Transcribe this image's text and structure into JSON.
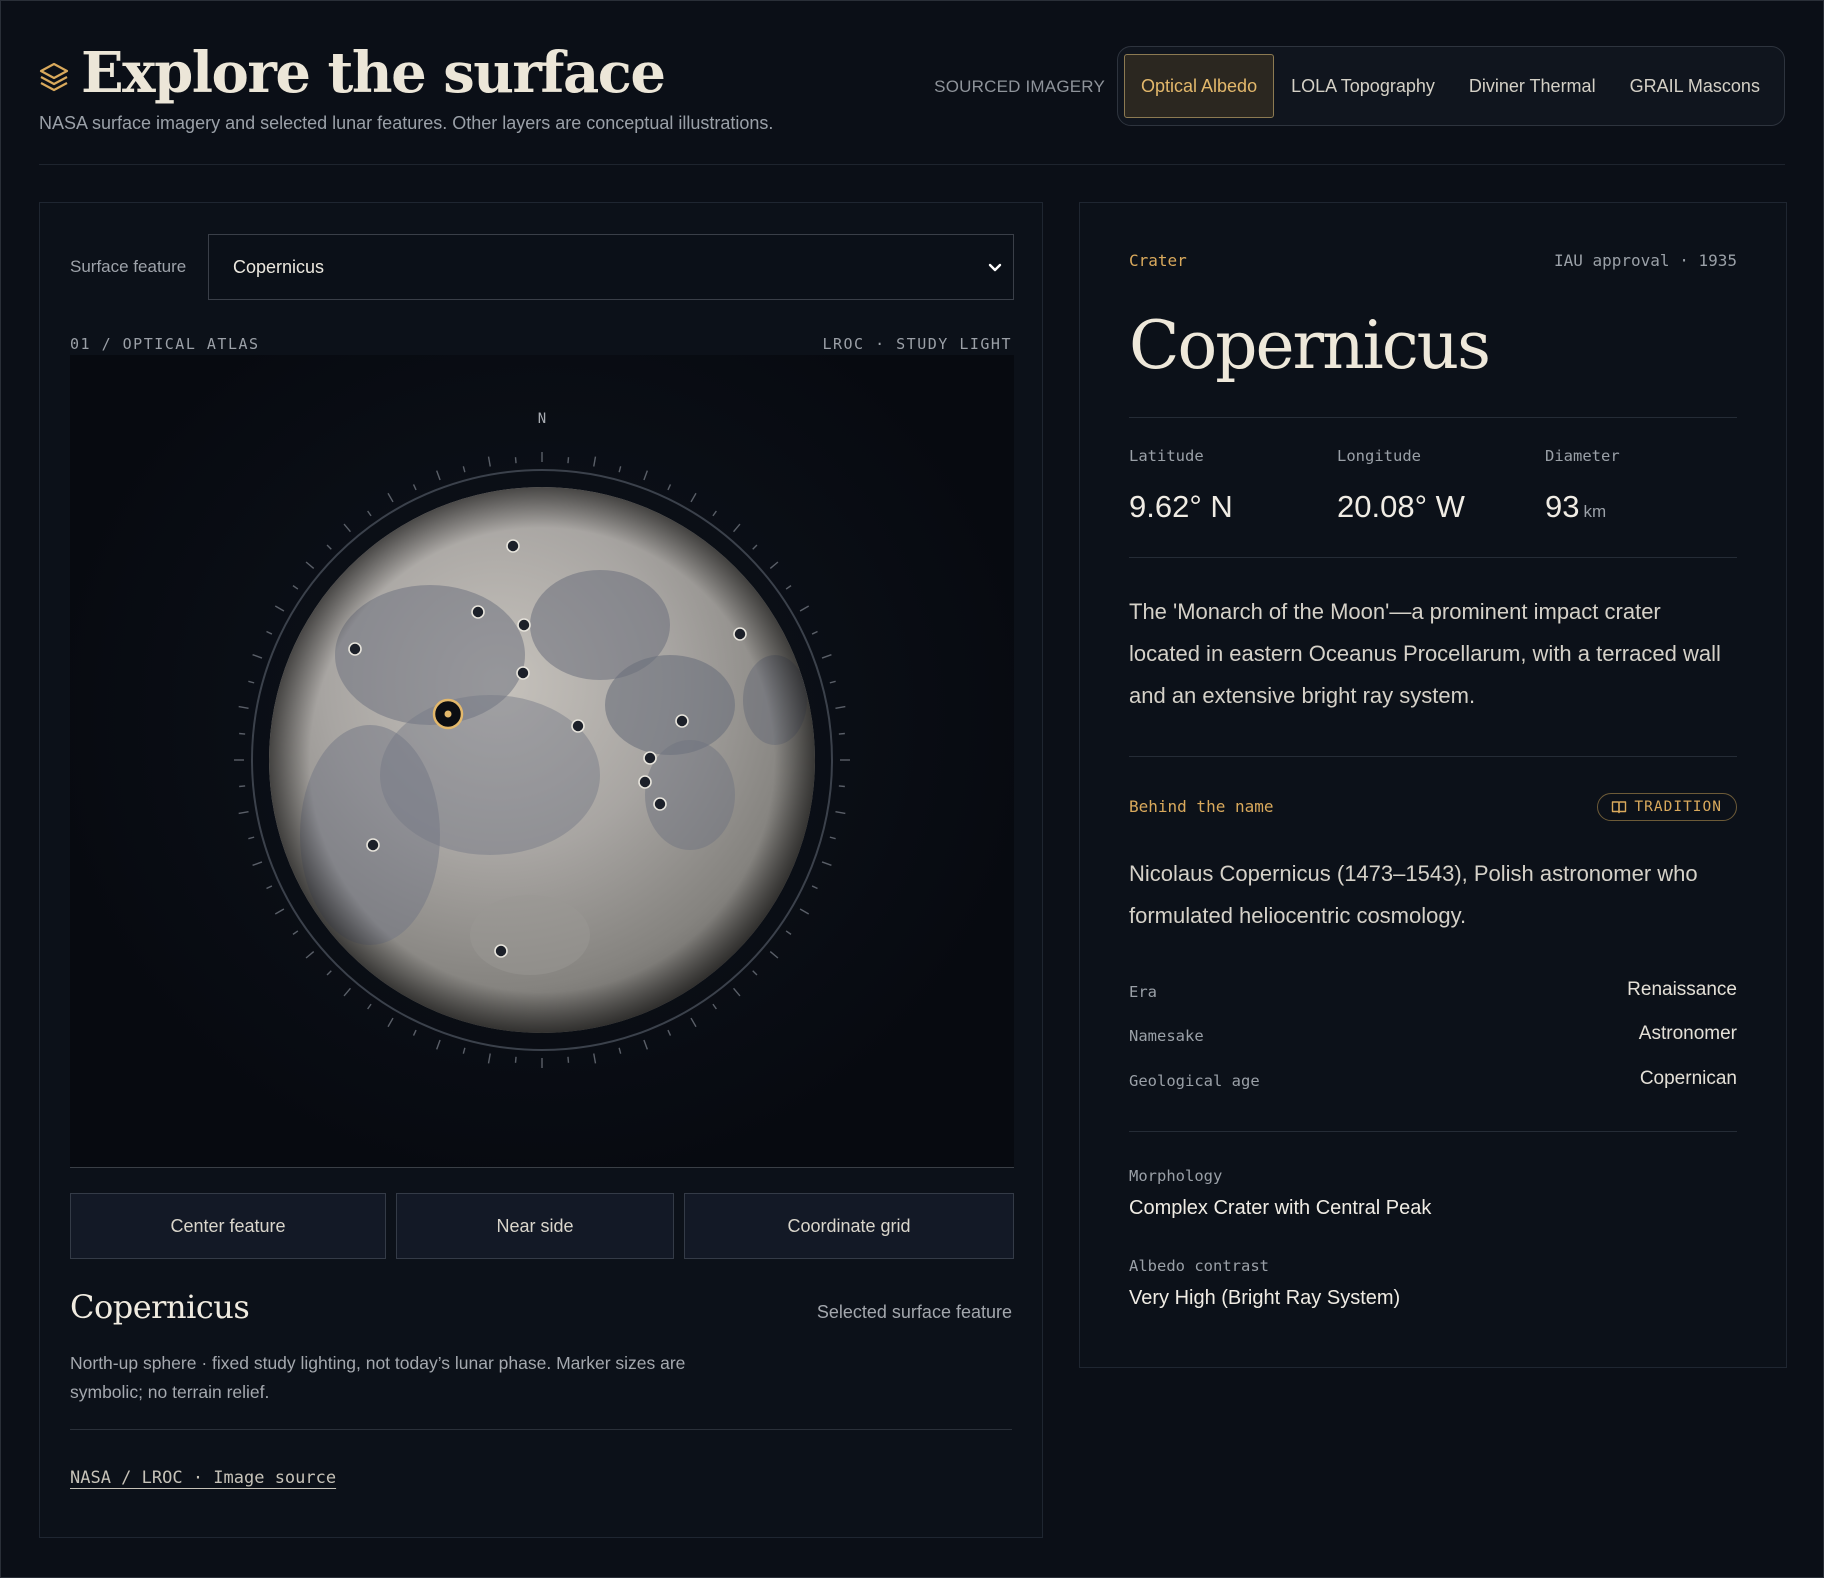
{
  "header": {
    "title": "Explore the surface",
    "subtitle": "NASA surface imagery and selected lunar features. Other layers are conceptual illustrations.",
    "sourced_label": "SOURCED IMAGERY",
    "layer_tabs": [
      {
        "label": "Optical Albedo",
        "active": true
      },
      {
        "label": "LOLA Topography",
        "active": false
      },
      {
        "label": "Diviner Thermal",
        "active": false
      },
      {
        "label": "GRAIL Mascons",
        "active": false
      }
    ]
  },
  "left": {
    "feature_label": "Surface feature",
    "feature_value": "Copernicus",
    "atlas_left": "01 / OPTICAL ATLAS",
    "atlas_right": "LROC · STUDY LIGHT",
    "compass_north": "N",
    "controls": [
      "Center feature",
      "Near side",
      "Coordinate grid"
    ],
    "selected_name": "Copernicus",
    "selected_caption": "Selected surface feature",
    "note": "North-up sphere · fixed study lighting, not today’s lunar phase. Marker sizes are symbolic; no terrain relief.",
    "source_link": "NASA / LROC · Image source"
  },
  "detail": {
    "kind": "Crater",
    "iau": "IAU approval · 1935",
    "name": "Copernicus",
    "stats": [
      {
        "label": "Latitude",
        "value": "9.62° N",
        "unit": ""
      },
      {
        "label": "Longitude",
        "value": "20.08° W",
        "unit": ""
      },
      {
        "label": "Diameter",
        "value": "93",
        "unit": "km"
      }
    ],
    "description": "The 'Monarch of the Moon'—a prominent impact crater located in eastern Oceanus Procellarum, with a terraced wall and an extensive bright ray system.",
    "behind_label": "Behind the name",
    "badge": "TRADITION",
    "honoree": "Nicolaus Copernicus (1473–1543), Polish astronomer who formulated heliocentric cosmology.",
    "facts": [
      {
        "key": "Era",
        "value": "Renaissance"
      },
      {
        "key": "Namesake",
        "value": "Astronomer"
      },
      {
        "key": "Geological age",
        "value": "Copernican"
      }
    ],
    "morphology_label": "Morphology",
    "morphology_value": "Complex Crater with Central Peak",
    "albedo_label": "Albedo contrast",
    "albedo_value": "Very High (Bright Ray System)"
  },
  "colors": {
    "accent": "#d9a95c",
    "background": "#0b0f17",
    "panel": "#0c1119",
    "active_tab_bg": "#2b2720"
  },
  "icons": [
    "layers-icon",
    "chevron-down-icon",
    "book-icon"
  ]
}
